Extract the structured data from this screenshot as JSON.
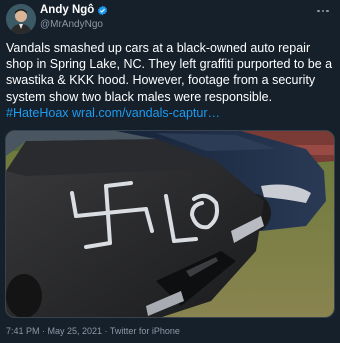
{
  "author": {
    "display_name": "Andy Ngô",
    "handle": "@MrAndyNgo",
    "verified_icon": "verified-badge-icon",
    "avatar_icon": "avatar"
  },
  "tweet": {
    "text": "Vandals smashed up cars at a black-owned auto repair shop in Spring Lake, NC. They left graffiti purported to be a swastika & KKK hood. However, footage from a security system show two black males were responsible.",
    "hashtag": "#HateHoax",
    "link": "wral.com/vandals-captur…",
    "photo_alt": "Photo of cars with white spray-painted graffiti on the hood"
  },
  "meta": {
    "timestamp": "7:41 PM · May 25, 2021 · Twitter for iPhone"
  },
  "colors": {
    "background": "#15202b",
    "link": "#1d9bf0",
    "secondary_text": "#8b98a5"
  }
}
